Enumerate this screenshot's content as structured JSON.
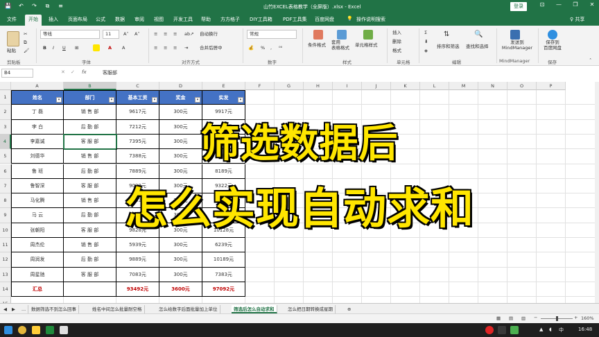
{
  "window": {
    "title": "山竹EXCEL表格教学（全屏版）.xlsx  -  Excel",
    "login": "登录",
    "controls": [
      "⊡",
      "—",
      "❐",
      "✕"
    ],
    "share": "♀ 共享"
  },
  "quick_access": [
    "💾",
    "↶",
    "↷",
    "⧉",
    "≡"
  ],
  "menu_tabs": [
    "文件",
    "开始",
    "插入",
    "页面布局",
    "公式",
    "数据",
    "审阅",
    "视图",
    "开发工具",
    "帮助",
    "方方格子",
    "DIY工具箱",
    "PDF工具集",
    "百度网盘",
    "操作说明搜索"
  ],
  "active_tab": "开始",
  "ribbon": {
    "font_name": "等线",
    "font_size": "11",
    "number_format": "常规",
    "wrap_text": "自动换行",
    "merge_center": "合并后居中",
    "conditional_format": "条件格式",
    "table_format": "套用\n表格格式",
    "cell_style": "单元格样式",
    "insert": "插入",
    "delete": "删除",
    "format": "格式",
    "sort_filter": "排序和筛选",
    "find_select": "查找和选择",
    "send_mm": "发送到\nMindManager",
    "save_baidu": "保存到\n百度网盘",
    "groups": [
      "剪贴板",
      "字体",
      "对齐方式",
      "数字",
      "样式",
      "单元格",
      "编辑",
      "MindManager",
      "保存"
    ],
    "font_buttons": [
      "B",
      "I",
      "U",
      "A",
      "A"
    ],
    "percent": "%",
    "thousands": ",",
    "paste_label": "粘贴"
  },
  "formula_bar": {
    "name_box": "B4",
    "fx": "fx",
    "content": "客服部",
    "cancel": "✕",
    "enter": "✓"
  },
  "columns": [
    "A",
    "B",
    "C",
    "D",
    "E",
    "F",
    "G",
    "H",
    "I",
    "J",
    "K",
    "L",
    "M",
    "N",
    "O",
    "P"
  ],
  "rows": [
    "1",
    "2",
    "3",
    "4",
    "5",
    "6",
    "7",
    "8",
    "9",
    "10",
    "11",
    "12",
    "13",
    "14",
    "15"
  ],
  "table": {
    "headers": [
      "姓名",
      "部门",
      "基本工资",
      "奖金",
      "实发"
    ],
    "rows": [
      [
        "丁  磊",
        "销 售 部",
        "9617元",
        "300元",
        "9917元"
      ],
      [
        "李  白",
        "后 勤 部",
        "7212元",
        "300元",
        "7512元"
      ],
      [
        "李嘉诚",
        "客 服 部",
        "7395元",
        "300元",
        "7695元"
      ],
      [
        "刘德华",
        "销 售 部",
        "7388元",
        "300元",
        "7688元"
      ],
      [
        "鲁  班",
        "后 勤 部",
        "7889元",
        "300元",
        "8189元"
      ],
      [
        "鲁智深",
        "客 服 部",
        "9022元",
        "300元",
        "9322元"
      ],
      [
        "马化腾",
        "销 售 部",
        "8433元",
        "300元",
        "8733元"
      ],
      [
        "马  云",
        "后 勤 部",
        "8525元",
        "300元",
        "8825元"
      ],
      [
        "张朝阳",
        "客 服 部",
        "9828元",
        "300元",
        "10128元"
      ],
      [
        "周杰伦",
        "销 售 部",
        "5939元",
        "300元",
        "6239元"
      ],
      [
        "周润发",
        "后 勤 部",
        "9889元",
        "300元",
        "10189元"
      ],
      [
        "周星驰",
        "客 服 部",
        "7083元",
        "300元",
        "7383元"
      ]
    ],
    "total": [
      "汇总",
      "",
      "93492元",
      "3600元",
      "97092元"
    ]
  },
  "overlay": {
    "line1": "筛选数据后",
    "line2": "怎么实现自动求和"
  },
  "sheet_tabs": [
    "...",
    "数据筛选不到怎么回事",
    "姓名中间怎么批量耐空格",
    "怎么给数字后面批量加上单位",
    "筛选后怎么自动求和",
    "怎么把日期转换成星期"
  ],
  "active_sheet": "筛选后怎么自动求和",
  "status": {
    "zoom": "160%",
    "zoom_minus": "−",
    "zoom_plus": "+"
  },
  "taskbar": {
    "time": "16:48",
    "lang": "中"
  }
}
